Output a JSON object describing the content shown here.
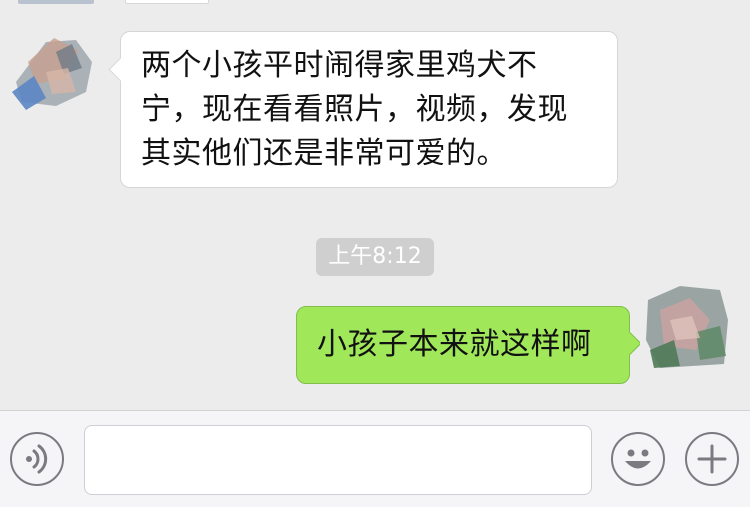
{
  "chat": {
    "messages": [
      {
        "side": "left",
        "text": "两个小孩平时闹得家里鸡犬不宁，现在看看照片，视频，发现其实他们还是非常可爱的。",
        "lines": [
          "两个小孩平时闹得家里鸡犬不",
          "宁，现在看看照片，视频，发现",
          "其实他们还是非常可爱的。"
        ]
      },
      {
        "side": "right",
        "text": "小孩子本来就这样啊"
      }
    ],
    "timestamp": "上午8:12"
  },
  "input_bar": {
    "placeholder": "",
    "icons": [
      "voice-icon",
      "emoji-icon",
      "plus-icon"
    ]
  },
  "colors": {
    "background": "#ececec",
    "incoming_bubble": "#ffffff",
    "outgoing_bubble": "#a0e75a",
    "timestamp_badge": "#cfcfcf"
  }
}
